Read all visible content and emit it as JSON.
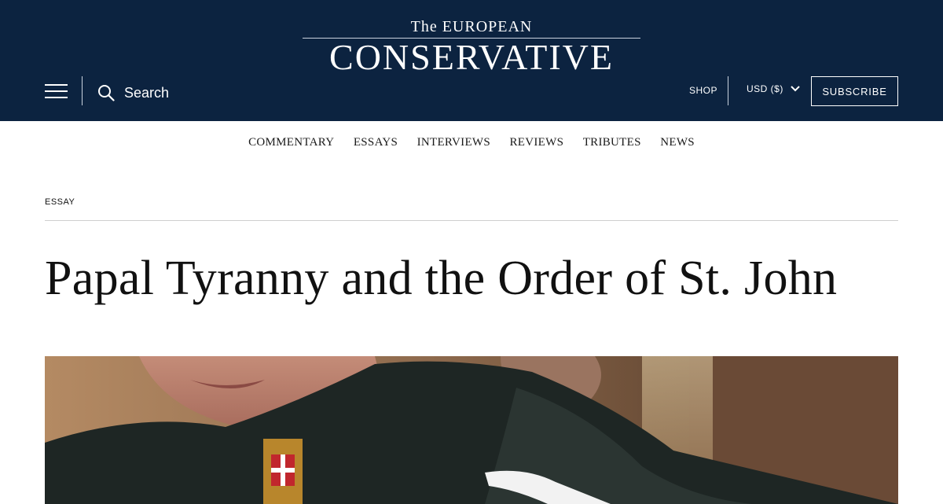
{
  "header": {
    "logo_top": "The EUROPEAN",
    "logo_main": "CONSERVATIVE",
    "search_label": "Search",
    "shop_label": "SHOP",
    "currency_label": "USD ($)",
    "subscribe_label": "SUBSCRIBE",
    "icons": [
      "menu-icon",
      "search-icon",
      "chevron-down-icon"
    ],
    "background_color": "#0c2340"
  },
  "nav": {
    "items": [
      "COMMENTARY",
      "ESSAYS",
      "INTERVIEWS",
      "REVIEWS",
      "TRIBUTES",
      "NEWS"
    ]
  },
  "article": {
    "kicker": "ESSAY",
    "title": "Papal Tyranny and the Order of St. John"
  }
}
